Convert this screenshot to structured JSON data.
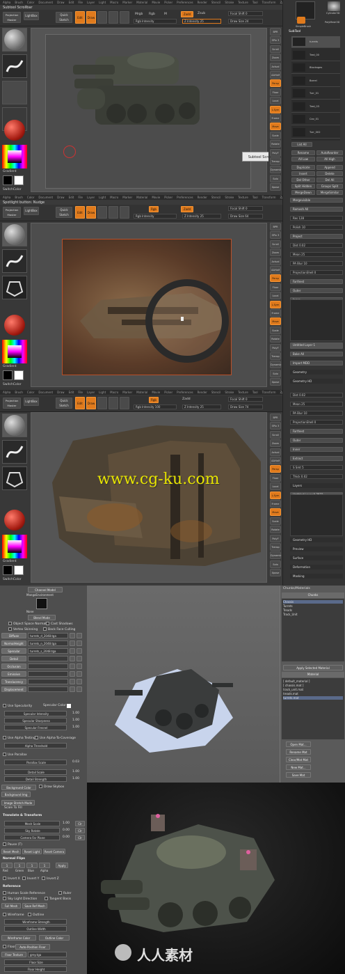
{
  "shot1": {
    "menu": [
      "Alpha",
      "Brush",
      "Color",
      "Document",
      "Draw",
      "Edit",
      "File",
      "Layer",
      "Light",
      "Macro",
      "Marker",
      "Material",
      "Movie",
      "Picker",
      "Preferences",
      "Render",
      "Stencil",
      "Stroke",
      "Texture",
      "Tool",
      "Transform",
      "Zplugin",
      "Zscript"
    ],
    "subtitle": "Subtool Scrollbar",
    "projection_master": "Projection Master",
    "lightbox": "LightBox",
    "quick_sketch": "Quick Sketch",
    "edit": "Edit",
    "draw": "Draw",
    "mrgb": "Mrgb",
    "rgb": "Rgb",
    "m": "M",
    "zadd": "Zadd",
    "zsub": "Zsub",
    "z_intensity": "Z Intensity 25",
    "rgb_intensity": "Rgb Intensity",
    "focal_shift": "Focal Shift 0",
    "draw_size": "Draw Size 24",
    "tooltip": "Subtool Scrollbar",
    "gradient": "Gradient",
    "switchcolor": "SwitchColor",
    "tool_items": [
      "Cylinder3D",
      "PolyMesh3D",
      "SimpleBrush"
    ],
    "subtool_label": "SubTool",
    "subtools": [
      "turrets",
      "Tred_00",
      "Blockages",
      "Barrel",
      "Turr_01",
      "Tred_03",
      "Cav_01",
      "Turr_002"
    ],
    "list_all": "List All",
    "rename": "Rename",
    "autoreorder": "AutoReorder",
    "all_low": "All Low",
    "all_high": "All High",
    "duplicate": "Duplicate",
    "append": "Append",
    "insert": "Insert",
    "delete": "Delete",
    "del_other": "Del Other",
    "del_all": "Del All",
    "split_hidden": "Split Hidden",
    "groups_split": "Groups Split",
    "mergedown": "MergeDown",
    "mergesimilar": "MergeSimilar",
    "right_btns": [
      "BPR",
      "SPix 3",
      "Scroll",
      "Zoom",
      "Actual",
      "AAHalf",
      "Persp",
      "Floor",
      "Local",
      "L.Sym",
      "Frame",
      "Move",
      "Scale",
      "Rotate",
      "PolyF",
      "Transp",
      "Dynamic",
      "Solo",
      "Xpose"
    ]
  },
  "shot2": {
    "subtitle": "Spotlight button: Nudge",
    "z_intensity": "Z Intensity 25",
    "draw_size": "Draw Size 64",
    "focal_shift": "Focal Shift 0",
    "rgb_intensity": "Rgb Intensity",
    "right_panel": [
      "Mergevisible",
      "Remesh All",
      "Res 128",
      "Polish 10",
      "Project",
      "Dist 0.02",
      "Mean 25",
      "PA Blur 10",
      "ProjectionShell 0",
      "Farthest",
      "Outer",
      "Inner",
      "Extract",
      "S Smt 5",
      "Thick 0.02",
      "Layers",
      "Untitled Layer 1",
      "Bake All",
      "Import MDD",
      "Geometry",
      "Geometry HD"
    ],
    "gradient": "Gradient",
    "switchcolor": "SwitchColor"
  },
  "shot3": {
    "watermark": "www.cg-ku.com",
    "z_intensity": "Z Intensity 25",
    "draw_size": "Draw Size 74",
    "focal_shift": "Focal Shift 0",
    "rgb_intensity": "Rgb Intensity 100",
    "right_panel": [
      "Dist 0.02",
      "Mean 25",
      "PA Blur 10",
      "ProjectionShell 0",
      "Farthest",
      "Outer",
      "Inner",
      "Extract",
      "S Smt 5",
      "Thick 0.02",
      "Layers",
      "Untitled Layer 0.7872",
      "Untitled Layer 0.6",
      "Bake All",
      "Import MDD",
      "Geometry",
      "Geometry HD",
      "Preview",
      "Surface",
      "Deformation",
      "Masking"
    ],
    "gradient": "Gradient",
    "switchcolor": "SwitchColor"
  },
  "shot4": {
    "channel_model": "Channel Model",
    "env": "MangoEnvironment",
    "none": "None",
    "blend_mode": "Blend Mode",
    "object_space_normals": "Object Space Normals",
    "cast_shadows": "Cast Shadows",
    "vertex_skinning": "Vertex Skinning",
    "back_face_culling": "Back Face Culling",
    "maps": [
      {
        "name": "Diffuse",
        "file": "turrets_d_2048.tga"
      },
      {
        "name": "NormalHeight",
        "file": "turrets_n_2048.tga"
      },
      {
        "name": "Specular",
        "file": "turrets_s_2048.tga"
      },
      {
        "name": "Detail",
        "file": ""
      },
      {
        "name": "Occlusion",
        "file": ""
      },
      {
        "name": "Emissive",
        "file": ""
      },
      {
        "name": "Translucency",
        "file": ""
      },
      {
        "name": "Displacement",
        "file": ""
      }
    ],
    "use_specularity": "Use Specularity",
    "specular_color": "Specular Color",
    "specular_intensity": "Specular Intensity",
    "specular_intensity_val": "1.00",
    "specular_sharpness": "Specular Sharpness",
    "specular_sharpness_val": "1.00",
    "specular_fresnel": "Specular Fresnel",
    "specular_fresnel_val": "1.00",
    "use_alpha_testing": "Use Alpha Testing",
    "use_alpha_coverage": "Use Alpha-To-Coverage",
    "alpha_threshold": "Alpha Threshold",
    "use_parallax": "Use Parallax",
    "parallax_scale": "Parallax Scale",
    "parallax_scale_val": "0.03",
    "detail_scale": "Detail Scale",
    "detail_scale_val": "1.00",
    "detail_strength": "Detail Strength",
    "detail_strength_val": "1.00",
    "background_color": "Background Color",
    "draw_skybox": "Draw Skybox",
    "background_img": "Background Img",
    "image_stretch_mode": "Image Stretch Mode",
    "scale_to_fit": "Scale To Fill",
    "transform_title": "Translate & Transform",
    "mesh_scale": "Mesh Scale",
    "mesh_scale_val": "1.00",
    "sky_rotate": "Sky Rotate",
    "sky_rotate_val": "0.00",
    "camera_far": "Camera Far Plane",
    "camera_far_val": "0.00",
    "pause": "Pause (T)",
    "reset_mesh": "Reset Mesh",
    "reset_light": "Reset Light",
    "reset_camera": "Reset Camera",
    "normal_flips": "Normal Flips",
    "flip_labels": [
      "Red",
      "Green",
      "Blue",
      "Alpha"
    ],
    "apply": "Apply",
    "invert_labels": [
      "Invert X",
      "Invert Y",
      "Invert Z"
    ],
    "reference": "Reference",
    "human_scale": "Human Scale Reference",
    "ruler": "Ruler",
    "sky_light_direction": "Sky Light Direction",
    "tangent_basis": "Tangent Basis",
    "full_mesh": "Full Mesh",
    "save_ref_mesh": "Save Ref Mesh",
    "wireframe": "Wireframe",
    "outline": "Outline",
    "wire_strength": "Wireframe Strength",
    "outline_width": "Outline Width",
    "wire_color": "Wireframe Color",
    "outline_color": "Outline Color",
    "floor": "Floor",
    "auto_position_floor": "Auto-Position Floor",
    "floor_texture": "Floor Texture",
    "floor_tex_file": "grey.tga",
    "floor_size": "Floor Size",
    "floor_height": "Floor Height",
    "chunks_materials": "Chunks/Materials",
    "chunks_title": "Chunks",
    "chunks": [
      "Chassis",
      "Turrets",
      "Treads",
      "Track_Unit"
    ],
    "apply_selected_material": "Apply Selected Material",
    "material_title": "Material",
    "materials": [
      "[ default_material ]",
      "[ chassis.mat ]",
      "track_unit.mat",
      "treads.mat",
      "turrets.mat"
    ],
    "mat_buttons": [
      "Open Mat...",
      "Rename Mat",
      "Clear/Mat Mat",
      "New Mat...",
      "Save Mat"
    ]
  },
  "footer_watermark": "人人素材",
  "colors": {
    "accent": "#e07a1c",
    "zbrush_bg": "#3a3a3a",
    "marmoset_bg": "#4e4e4e",
    "watermark_yellow": "#e8e400"
  }
}
